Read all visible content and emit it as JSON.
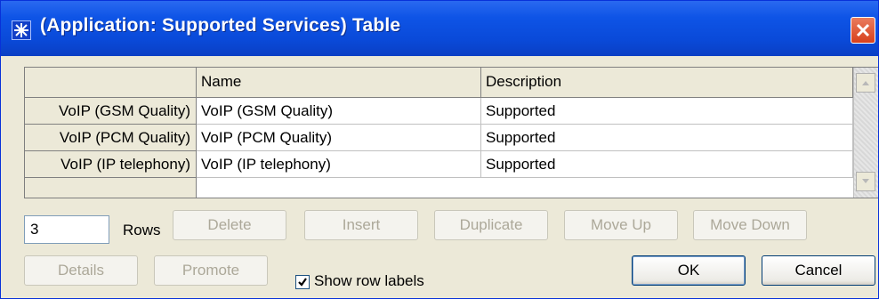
{
  "window": {
    "title": "(Application: Supported Services) Table"
  },
  "table": {
    "columns": [
      "Name",
      "Description"
    ],
    "rows": [
      {
        "label": "VoIP (GSM Quality)",
        "name": "VoIP (GSM Quality)",
        "description": "Supported"
      },
      {
        "label": "VoIP (PCM Quality)",
        "name": "VoIP (PCM Quality)",
        "description": "Supported"
      },
      {
        "label": "VoIP (IP telephony)",
        "name": "VoIP (IP telephony)",
        "description": "Supported"
      }
    ]
  },
  "controls": {
    "rows_value": "3",
    "rows_label": "Rows",
    "delete": "Delete",
    "insert": "Insert",
    "duplicate": "Duplicate",
    "move_up": "Move Up",
    "move_down": "Move Down",
    "details": "Details",
    "promote": "Promote",
    "show_row_labels": "Show row labels",
    "show_row_labels_checked": true,
    "ok": "OK",
    "cancel": "Cancel"
  }
}
